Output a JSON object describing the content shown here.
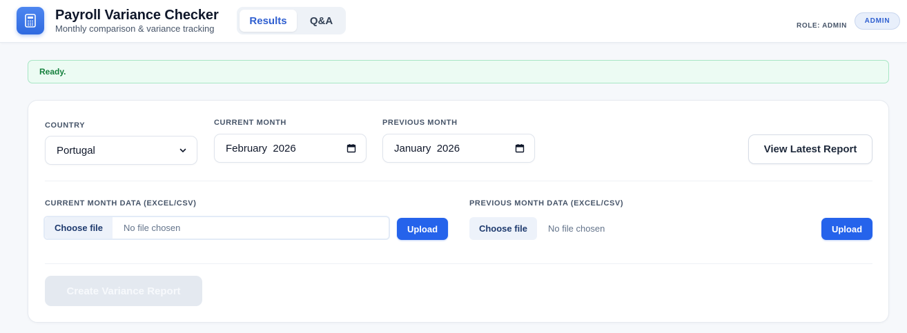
{
  "header": {
    "title": "Payroll Variance Checker",
    "subtitle": "Monthly comparison & variance tracking",
    "app_icon": "calculator-icon",
    "tabs": [
      {
        "label": "Results",
        "active": true
      },
      {
        "label": "Q&A",
        "active": false
      }
    ],
    "role_text": "ROLE: ADMIN",
    "role_badge": "ADMIN"
  },
  "status": {
    "text": "Ready.",
    "color": "#15803d"
  },
  "form": {
    "country": {
      "label": "COUNTRY",
      "value": "Portugal",
      "icon": "chevron-down-icon"
    },
    "current_month": {
      "label": "CURRENT MONTH",
      "value": "February  2026",
      "icon": "calendar-icon"
    },
    "previous_month": {
      "label": "PREVIOUS MONTH",
      "value": "January  2026",
      "icon": "calendar-icon"
    },
    "view_report_label": "View Latest Report",
    "current_upload": {
      "label": "CURRENT MONTH DATA (EXCEL/CSV)",
      "choose_label": "Choose file",
      "file_status": "No file chosen",
      "upload_label": "Upload"
    },
    "previous_upload": {
      "label": "PREVIOUS MONTH DATA (EXCEL/CSV)",
      "choose_label": "Choose file",
      "file_status": "No file chosen",
      "upload_label": "Upload"
    },
    "create_label": "Create Variance Report"
  },
  "colors": {
    "accent": "#2563eb",
    "status_bg": "#ecfbf3"
  }
}
